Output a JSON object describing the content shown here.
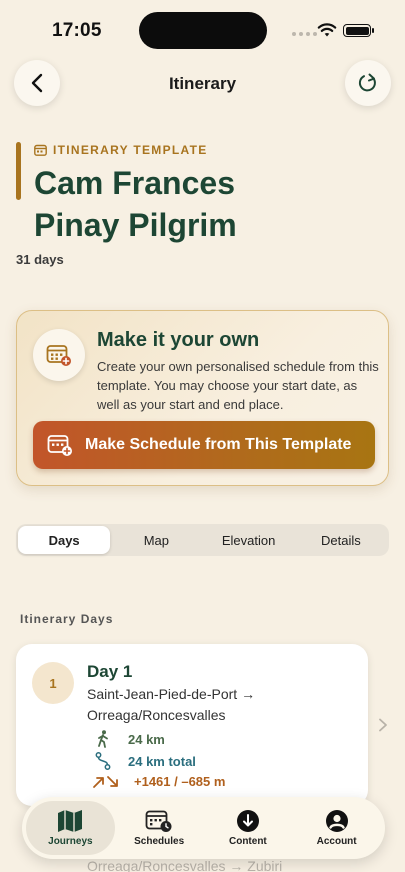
{
  "status": {
    "time": "17:05"
  },
  "nav": {
    "title": "Itinerary"
  },
  "header": {
    "eyebrow": "ITINERARY TEMPLATE",
    "title_line1": "Cam Frances",
    "title_line2": "Pinay Pilgrim",
    "duration": "31 days"
  },
  "own_card": {
    "title": "Make it your own",
    "description": "Create your own personalised schedule from this template. You may choose your start date, as well as your start and end place.",
    "button_label": "Make Schedule from This Template"
  },
  "tabs": [
    {
      "label": "Days",
      "active": true
    },
    {
      "label": "Map",
      "active": false
    },
    {
      "label": "Elevation",
      "active": false
    },
    {
      "label": "Details",
      "active": false
    }
  ],
  "section_label": "Itinerary Days",
  "days": [
    {
      "number": "1",
      "title": "Day 1",
      "route": "Saint-Jean-Pied-de-Port → Orreaga/Roncesvalles",
      "distance": "24 km",
      "total": "24 km total",
      "elevation": "+1461 / –685 m"
    }
  ],
  "next_day_peek": "Orreaga/Roncesvalles → Zubiri",
  "tabbar": [
    {
      "label": "Journeys",
      "icon": "map-icon",
      "active": true
    },
    {
      "label": "Schedules",
      "icon": "calendar-clock-icon",
      "active": false
    },
    {
      "label": "Content",
      "icon": "download-icon",
      "active": false
    },
    {
      "label": "Account",
      "icon": "account-icon",
      "active": false
    }
  ],
  "colors": {
    "background": "#f7f0e3",
    "brand_green": "#1d4634",
    "accent_gold": "#a8741f",
    "button_orange": "#c2552a"
  }
}
